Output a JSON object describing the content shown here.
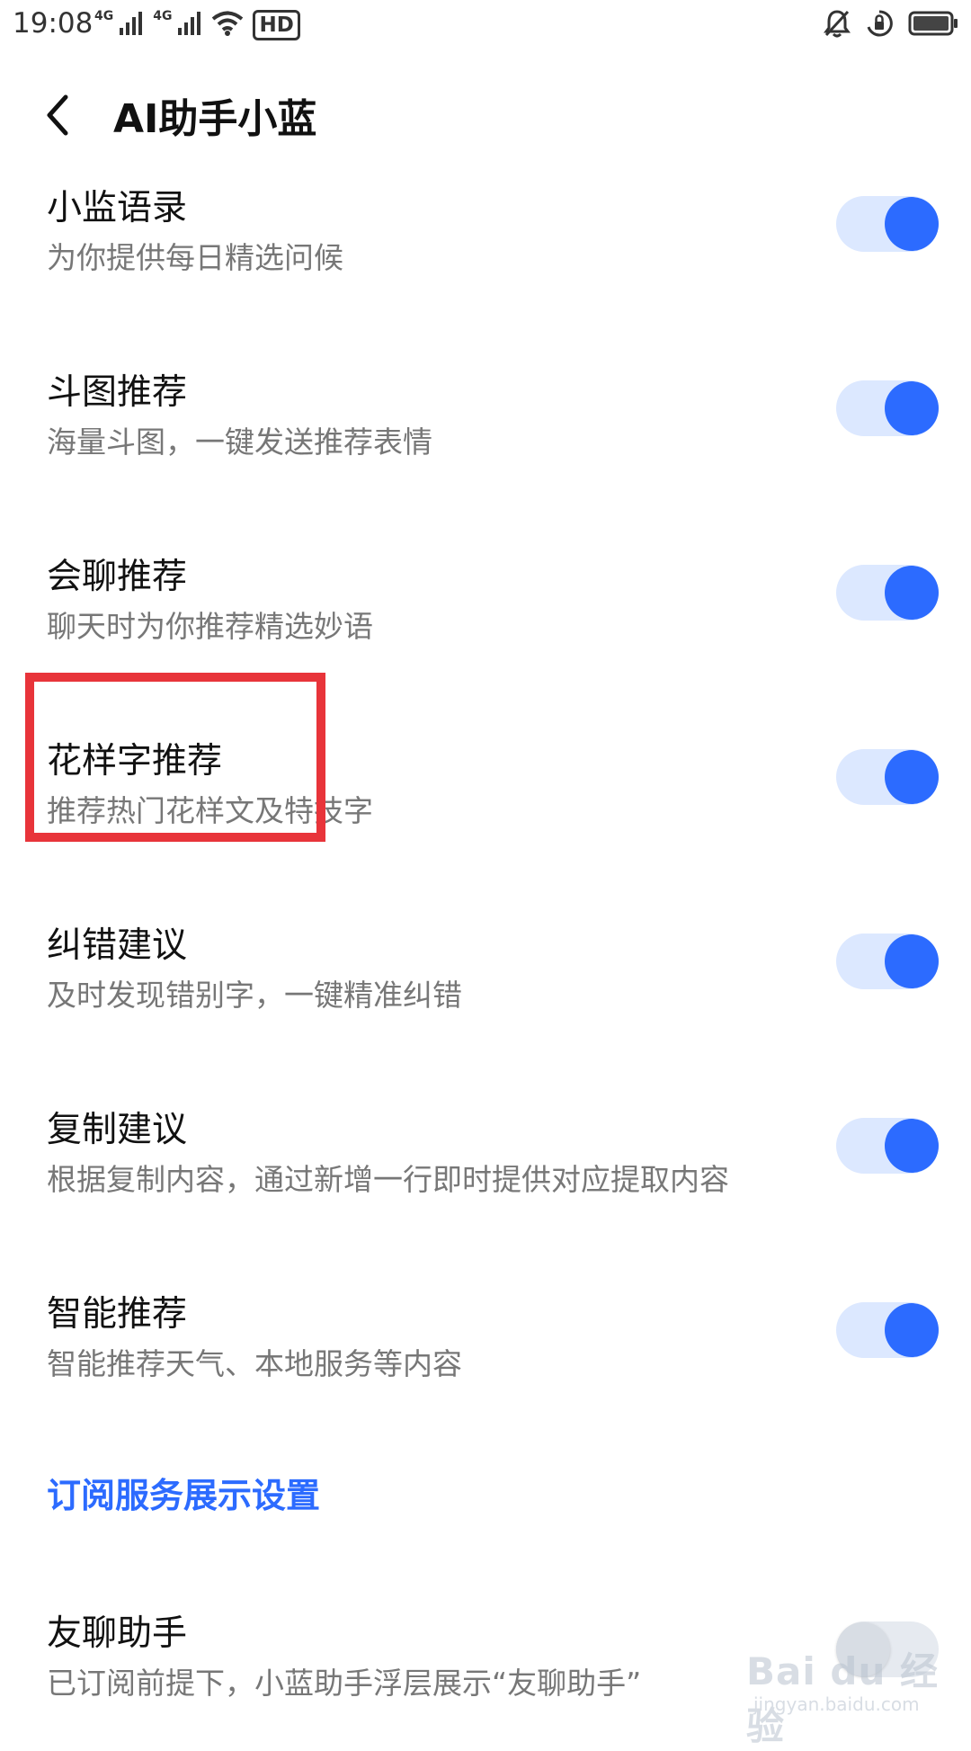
{
  "status_bar": {
    "time": "19:08",
    "network_1": "4G",
    "network_2": "4G",
    "hd_badge": "HD",
    "icons": [
      "signal-icon",
      "signal-icon",
      "wifi-icon",
      "hd-icon",
      "mute-bell-icon",
      "rotation-lock-icon",
      "battery-icon"
    ]
  },
  "header": {
    "back_icon": "chevron-left-icon",
    "title": "AI助手小蓝"
  },
  "settings": [
    {
      "title": "小监语录",
      "desc": "为你提供每日精选问候",
      "enabled": true
    },
    {
      "title": "斗图推荐",
      "desc": "海量斗图，一键发送推荐表情",
      "enabled": true
    },
    {
      "title": "会聊推荐",
      "desc": "聊天时为你推荐精选妙语",
      "enabled": true
    },
    {
      "title": "花样字推荐",
      "desc": "推荐热门花样文及特技字",
      "enabled": true
    },
    {
      "title": "纠错建议",
      "desc": "及时发现错别字，一键精准纠错",
      "enabled": true
    },
    {
      "title": "复制建议",
      "desc": "根据复制内容，通过新增一行即时提供对应提取内容",
      "enabled": true
    },
    {
      "title": "智能推荐",
      "desc": "智能推荐天气、本地服务等内容",
      "enabled": true
    }
  ],
  "section_link": "订阅服务展示设置",
  "subscription_setting": {
    "title": "友聊助手",
    "desc": "已订阅前提下，小蓝助手浮层展示“友聊助手”",
    "enabled": false
  },
  "colors": {
    "accent": "#2c6bff",
    "toggle_track_on": "#dce8ff",
    "highlight": "#e8343a"
  },
  "watermark": {
    "main": "Bai du 经验",
    "sub": "jingyan.baidu.com"
  }
}
